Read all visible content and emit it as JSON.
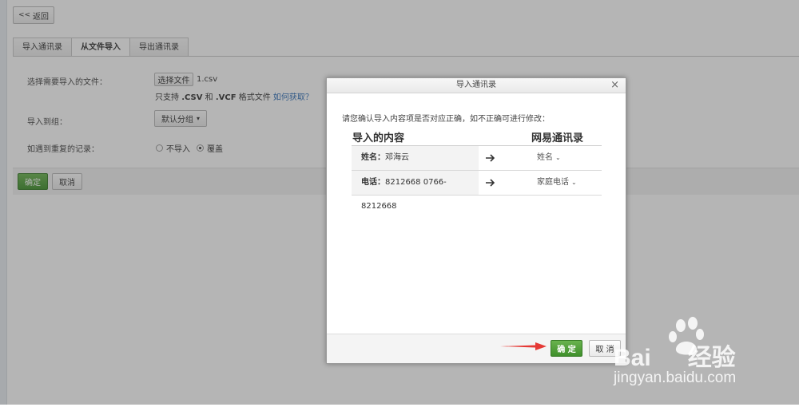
{
  "header": {
    "back_label": "返回"
  },
  "tabs": [
    {
      "label": "导入通讯录",
      "active": false
    },
    {
      "label": "从文件导入",
      "active": true
    },
    {
      "label": "导出通讯录",
      "active": false
    }
  ],
  "form": {
    "file_label": "选择需要导入的文件：",
    "choose_file_button": "选择文件",
    "file_name": "1.csv",
    "support_prefix": "只支持",
    "support_csv": ".CSV",
    "support_and": "和",
    "support_vcf": ".VCF",
    "support_suffix": "格式文件",
    "how_link": "如何获取？",
    "group_label": "导入到组：",
    "group_select": "默认分组",
    "duplicate_label": "如遇到重复的记录：",
    "radio_skip": "不导入",
    "radio_overwrite": "覆盖",
    "radio_selected": "覆盖"
  },
  "actions": {
    "confirm": "确定",
    "cancel": "取消"
  },
  "dialog": {
    "title": "导入通讯录",
    "close": "×",
    "hint": "请您确认导入内容项是否对应正确，如不正确可进行修改：",
    "col_source": "导入的内容",
    "col_target": "网易通讯录",
    "rows": [
      {
        "source_key": "姓名：",
        "source_value": "邓海云",
        "target": "姓名"
      },
      {
        "source_key": "电话：",
        "source_value": "8212668 0766-8212668",
        "target": "家庭电话"
      }
    ],
    "confirm": "确 定",
    "cancel": "取 消"
  },
  "watermark": {
    "brand": "Bai",
    "brand2": "经验",
    "url": "jingyan.baidu.com"
  },
  "colors": {
    "accent_green": "#3f8f2b",
    "link_blue": "#2f6fb7",
    "arrow_red": "#e53935"
  }
}
